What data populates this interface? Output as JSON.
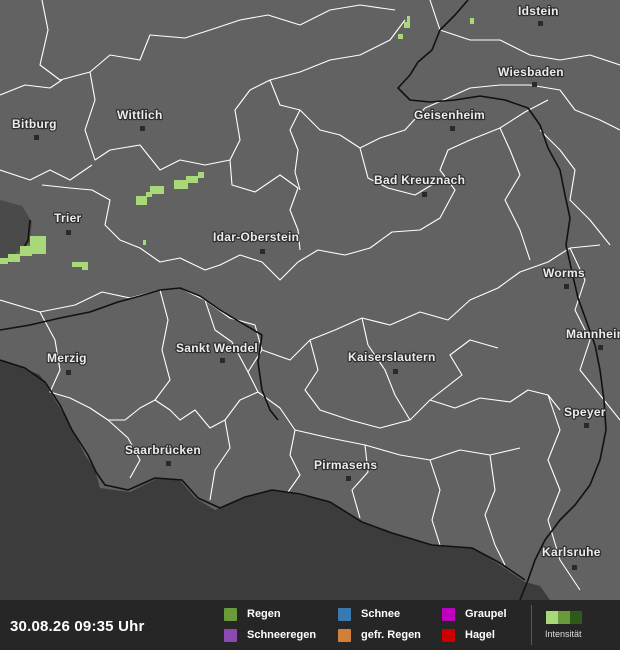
{
  "map": {
    "background_color": "#626262",
    "outside_color": "#3c3c3c",
    "border_color": "#ffffff",
    "country_border_color": "#111111",
    "rain_color": "#a8d878",
    "cities": [
      {
        "name": "Idstein"
      },
      {
        "name": "Wiesbaden"
      },
      {
        "name": "Bitburg"
      },
      {
        "name": "Wittlich"
      },
      {
        "name": "Geisenheim"
      },
      {
        "name": "Bad Kreuznach"
      },
      {
        "name": "Trier"
      },
      {
        "name": "Idar-Oberstein"
      },
      {
        "name": "Worms"
      },
      {
        "name": "Mannheim"
      },
      {
        "name": "Merzig"
      },
      {
        "name": "Sankt Wendel"
      },
      {
        "name": "Kaiserslautern"
      },
      {
        "name": "Speyer"
      },
      {
        "name": "Saarbrücken"
      },
      {
        "name": "Pirmasens"
      },
      {
        "name": "Karlsruhe"
      }
    ]
  },
  "footer": {
    "timestamp": "30.08.26 09:35 Uhr",
    "legend": [
      {
        "label": "Regen",
        "color": "#6a9a3a"
      },
      {
        "label": "Schneeregen",
        "color": "#8a4ab0"
      },
      {
        "label": "Schnee",
        "color": "#3a7ab0"
      },
      {
        "label": "gefr. Regen",
        "color": "#d0803a"
      },
      {
        "label": "Graupel",
        "color": "#c000c0"
      },
      {
        "label": "Hagel",
        "color": "#cc0000"
      }
    ],
    "intensity_label": "Intensität",
    "intensity_colors": [
      "#a8d878",
      "#6a9a3a",
      "#2e5a18"
    ]
  }
}
